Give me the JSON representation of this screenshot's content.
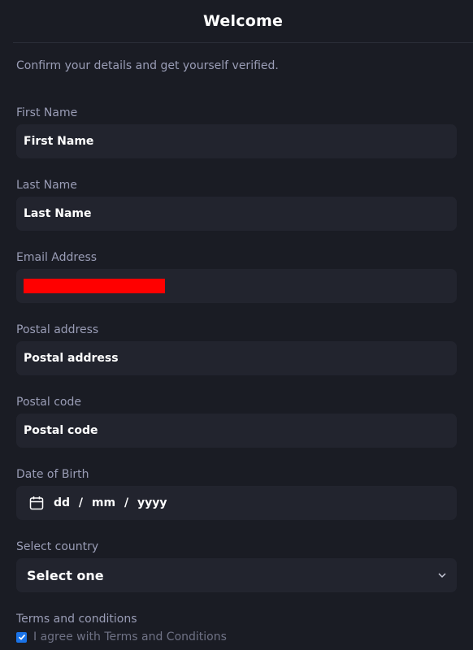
{
  "header": {
    "title": "Welcome"
  },
  "subtitle": "Confirm your details and get yourself verified.",
  "fields": [
    {
      "label": "First Name",
      "placeholder": "First Name"
    },
    {
      "label": "Last Name",
      "placeholder": "Last Name"
    },
    {
      "label": "Email Address",
      "value": ""
    },
    {
      "label": "Postal address",
      "placeholder": "Postal address"
    },
    {
      "label": "Postal code",
      "placeholder": "Postal code"
    },
    {
      "label": "Date of Birth",
      "placeholder": "dd / mm / yyyy"
    }
  ],
  "country": {
    "label": "Select country",
    "selected": "Select one"
  },
  "terms": {
    "label": "Terms and conditions",
    "checkbox_label": "I agree with Terms and Conditions",
    "checked": true
  },
  "colors": {
    "background": "#1a1c24",
    "field": "#22242e",
    "label": "#9a9db6",
    "redaction": "#ff0000",
    "checkbox": "#1a73e8"
  },
  "icons": [
    "calendar-icon",
    "chevron-down-icon",
    "checkmark-icon"
  ]
}
